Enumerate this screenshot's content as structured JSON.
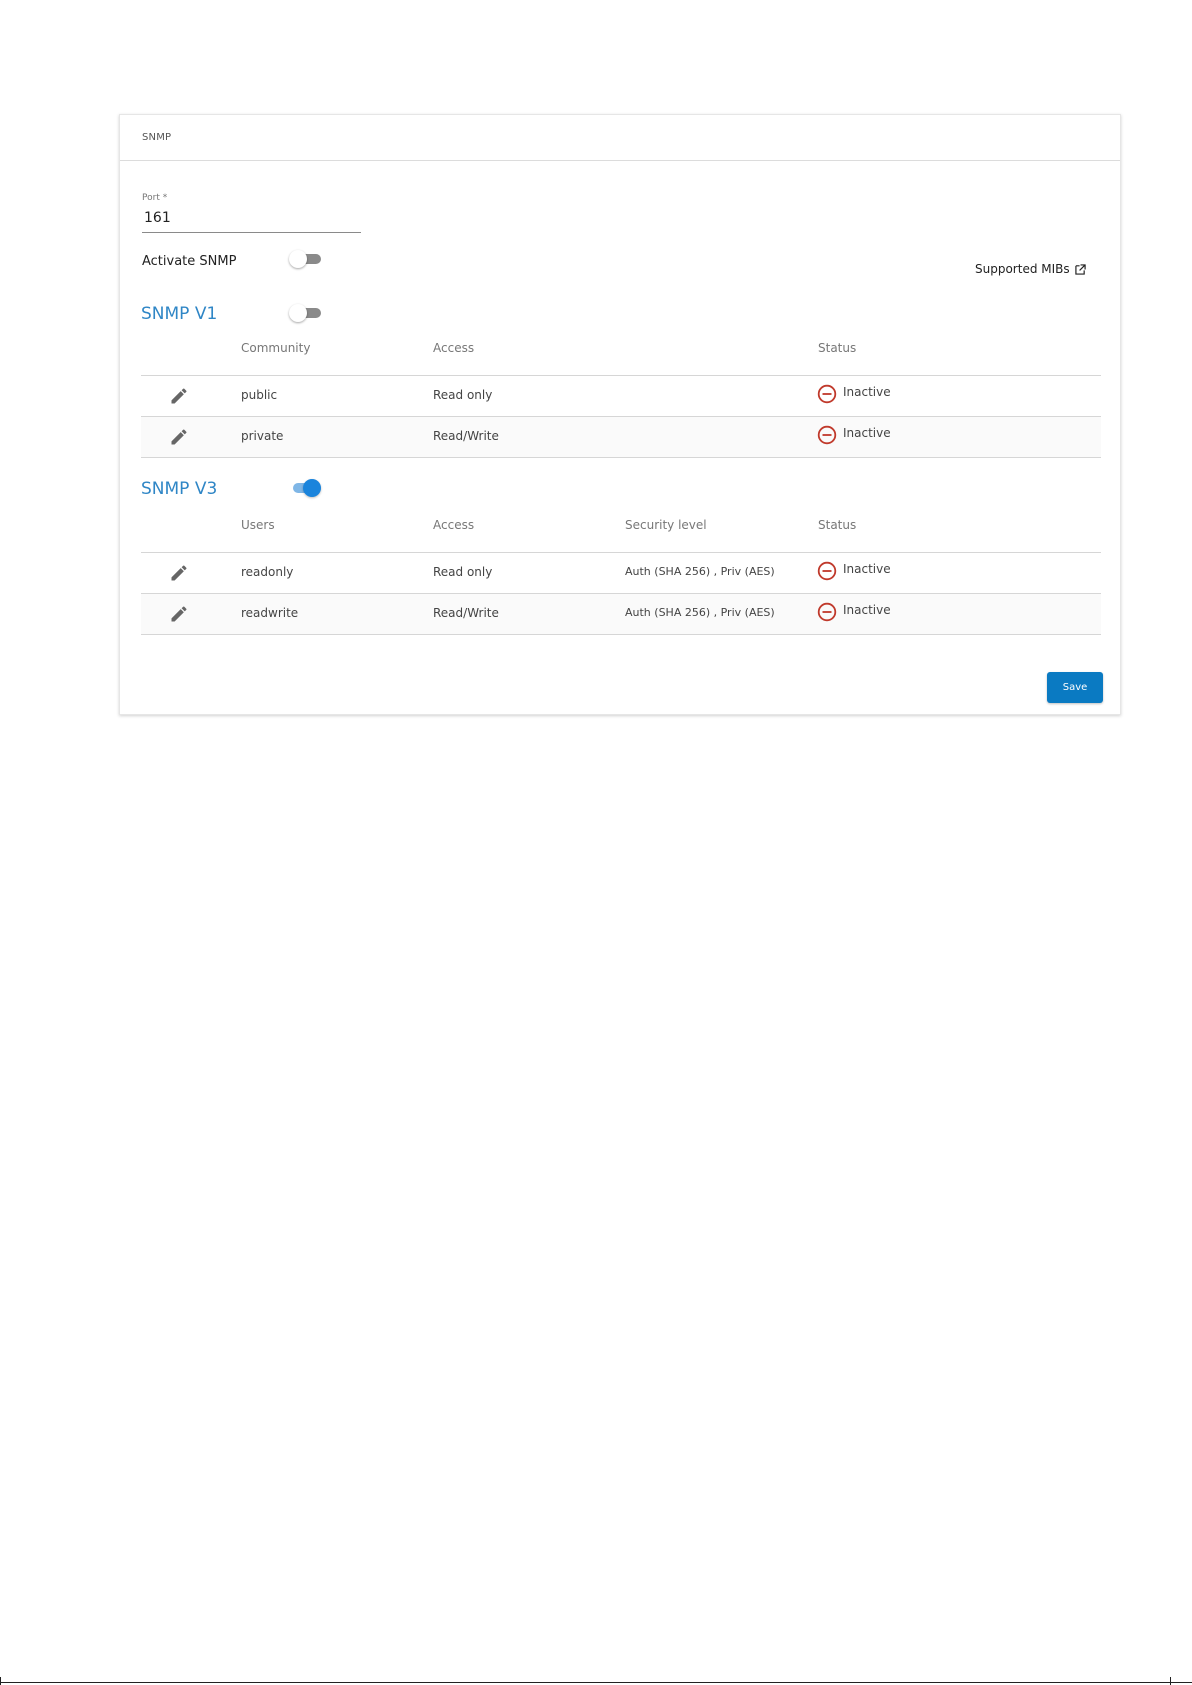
{
  "panel": {
    "title": "SNMP"
  },
  "port": {
    "label": "Port *",
    "value": "161"
  },
  "activate": {
    "label": "Activate SNMP",
    "enabled": false
  },
  "mibs_link": {
    "label": "Supported MIBs",
    "icon": "external-link-icon"
  },
  "snmp_v1": {
    "title": "SNMP V1",
    "enabled": false,
    "columns": [
      "Community",
      "Access",
      "Status"
    ],
    "rows": [
      {
        "community": "public",
        "access": "Read only",
        "status": "Inactive"
      },
      {
        "community": "private",
        "access": "Read/Write",
        "status": "Inactive"
      }
    ]
  },
  "snmp_v3": {
    "title": "SNMP V3",
    "enabled": true,
    "columns": [
      "Users",
      "Access",
      "Security level",
      "Status"
    ],
    "rows": [
      {
        "user": "readonly",
        "access": "Read only",
        "security": "Auth (SHA 256) , Priv (AES)",
        "status": "Inactive"
      },
      {
        "user": "readwrite",
        "access": "Read/Write",
        "security": "Auth (SHA 256) , Priv (AES)",
        "status": "Inactive"
      }
    ]
  },
  "actions": {
    "save_label": "Save"
  },
  "colors": {
    "accent": "#2f86c6",
    "primary_button": "#0a7ac2",
    "toggle_on": "#1a84dc",
    "status_inactive": "#c0392b"
  }
}
